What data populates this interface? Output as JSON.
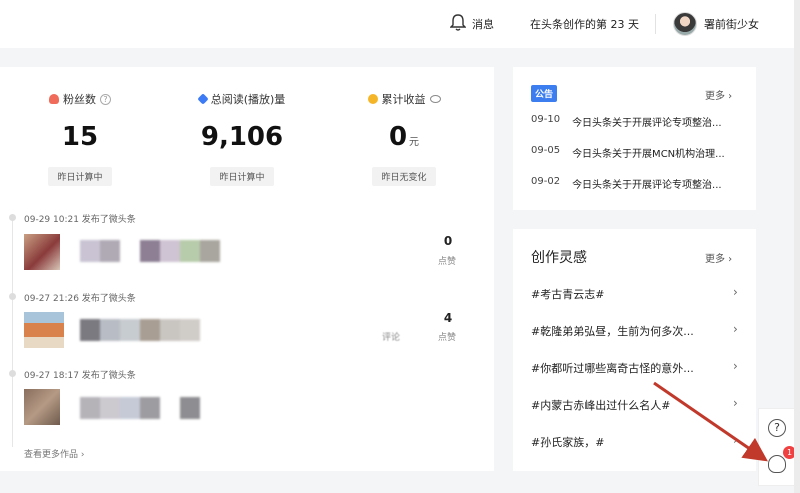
{
  "header": {
    "message_label": "消息",
    "creation_days": "在头条创作的第 23 天",
    "username": "署前街少女"
  },
  "stats": [
    {
      "label": "粉丝数",
      "value": "15",
      "unit": "",
      "note": "昨日计算中"
    },
    {
      "label": "总阅读(播放)量",
      "value": "9,106",
      "unit": "",
      "note": "昨日计算中"
    },
    {
      "label": "累计收益",
      "value": "0",
      "unit": "元",
      "note": "昨日无变化"
    }
  ],
  "posts": [
    {
      "meta": "09-29 10:21  发布了微头条",
      "count": "0",
      "count_label": "点赞",
      "extra_label": ""
    },
    {
      "meta": "09-27 21:26  发布了微头条",
      "count": "4",
      "count_label": "点赞",
      "extra_label": "评论"
    },
    {
      "meta": "09-27 18:17  发布了微头条",
      "count": "",
      "count_label": "",
      "extra_label": ""
    }
  ],
  "more_works": "查看更多作品",
  "notice": {
    "tag": "公告",
    "more": "更多",
    "items": [
      {
        "date": "09-10",
        "title": "今日头条关于开展评论专项整治..."
      },
      {
        "date": "09-05",
        "title": "今日头条关于开展MCN机构治理..."
      },
      {
        "date": "09-02",
        "title": "今日头条关于开展评论专项整治..."
      }
    ]
  },
  "inspiration": {
    "title": "创作灵感",
    "more": "更多",
    "items": [
      "#考古青云志#",
      "#乾隆弟弟弘昼，生前为何多次...",
      "#你都听过哪些离奇古怪的意外...",
      "#内蒙古赤峰出过什么名人#",
      "#孙氏家族，#"
    ]
  },
  "float": {
    "help": "?",
    "badge": "1"
  },
  "colors": {
    "accent_blue": "#3c7ef0",
    "badge_red": "#f04142",
    "arrow_red": "#c0392b"
  }
}
